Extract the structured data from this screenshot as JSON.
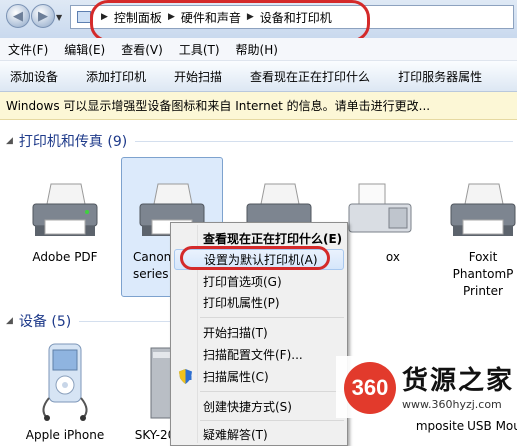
{
  "breadcrumb": {
    "items": [
      "控制面板",
      "硬件和声音",
      "设备和打印机"
    ]
  },
  "menubar": {
    "items": [
      "文件(F)",
      "编辑(E)",
      "查看(V)",
      "工具(T)",
      "帮助(H)"
    ]
  },
  "toolbar": {
    "items": [
      "添加设备",
      "添加打印机",
      "开始扫描",
      "查看现在正在打印什么",
      "打印服务器属性"
    ]
  },
  "infobar": {
    "text": "Windows 可以显示增强型设备图标和来自 Internet 的信息。请单击进行更改..."
  },
  "sections": {
    "printers": {
      "label": "打印机和传真 (9)"
    },
    "devices": {
      "label": "设备 (5)"
    }
  },
  "printers": [
    {
      "label": "Adobe PDF"
    },
    {
      "label": "Canon\nseries"
    },
    {
      "label": ""
    },
    {
      "label": "ox"
    },
    {
      "label": "Foxit\nPhantomP\nPrinter"
    }
  ],
  "devices": [
    {
      "label": "Apple iPhone"
    },
    {
      "label": "SKY-20"
    },
    {
      "label": "mposite"
    },
    {
      "label": "USB Mou"
    }
  ],
  "context_menu": {
    "items": [
      {
        "label": "查看现在正在打印什么(E)"
      },
      {
        "label": "设置为默认打印机(A)"
      },
      {
        "label": "打印首选项(G)"
      },
      {
        "label": "打印机属性(P)"
      },
      {
        "label": "开始扫描(T)"
      },
      {
        "label": "扫描配置文件(F)..."
      },
      {
        "label": "扫描属性(C)"
      },
      {
        "label": "创建快捷方式(S)"
      },
      {
        "label": "疑难解答(T)"
      }
    ]
  },
  "watermark": {
    "logo": "360",
    "title": "货源之家",
    "url": "www.360hyzj.com"
  },
  "colors": {
    "annotation_red": "#d42a2a",
    "section_blue": "#1e3a8a",
    "info_yellow": "#fcf7d6",
    "selection_blue": "#dceafb"
  }
}
